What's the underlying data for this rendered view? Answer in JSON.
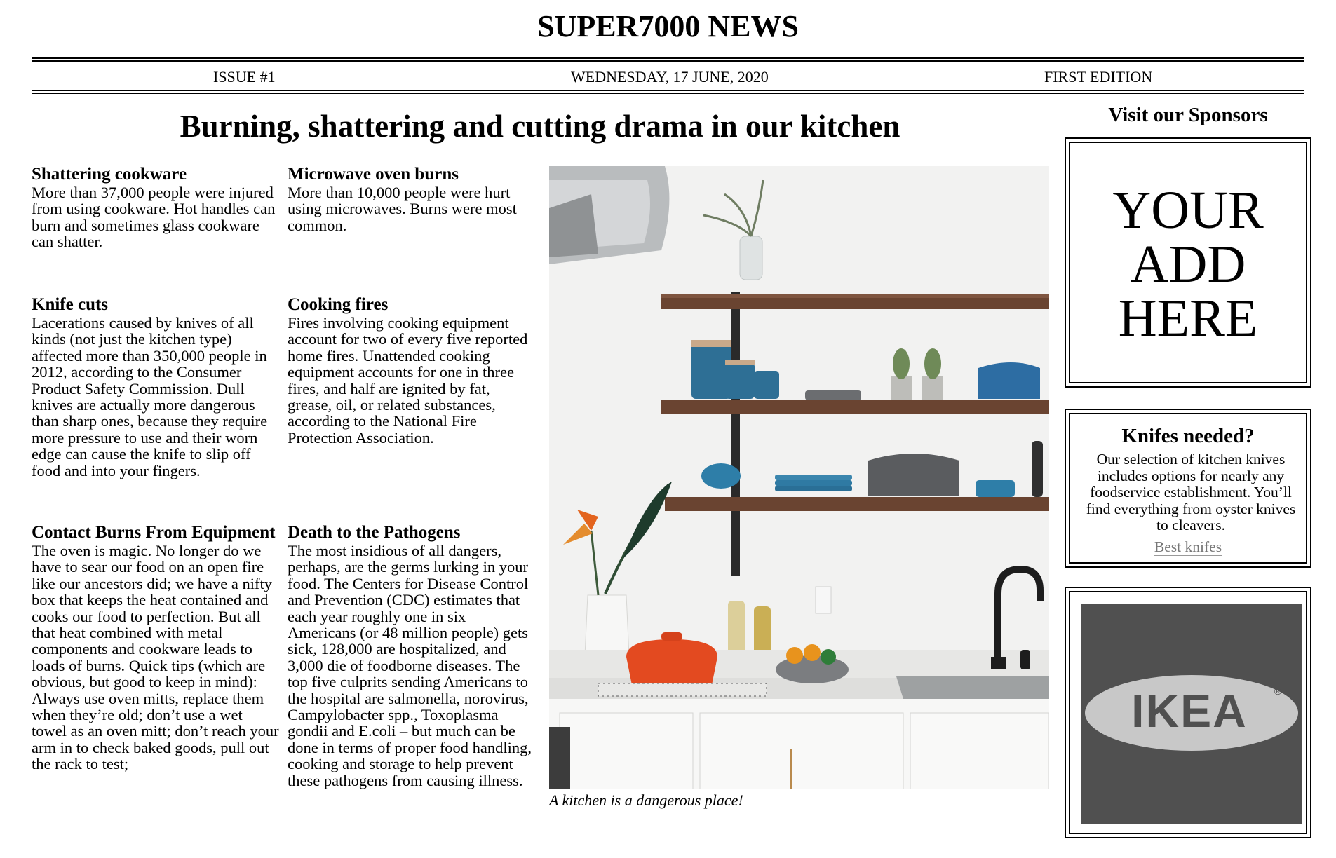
{
  "masthead": {
    "title": "SUPER7000 NEWS"
  },
  "issue_bar": {
    "issue": "ISSUE #1",
    "date": "WEDNESDAY, 17 JUNE, 2020",
    "edition": "FIRST EDITION"
  },
  "headline": "Burning, shattering and cutting drama in our kitchen",
  "articles": [
    {
      "title": "Shattering cookware",
      "body": "More than 37,000 people were injured from using cookware. Hot handles can burn and sometimes glass cookware can shatter."
    },
    {
      "title": "Microwave oven burns",
      "body": "More than 10,000 people were hurt using microwaves. Burns were most common."
    },
    {
      "title": "Knife cuts",
      "body": "Lacerations caused by knives of all kinds (not just the kitchen type) affected more than 350,000 people in 2012, according to the Consumer Product Safety Commission. Dull knives are actually more dangerous than sharp ones, because they require more pressure to use and their worn edge can cause the knife to slip off food and into your fingers."
    },
    {
      "title": "Cooking fires",
      "body": "Fires involving cooking equipment account for two of every five reported home fires. Unattended cooking equipment accounts for one in three fires, and half are ignited by fat, grease, oil, or related substances, according to the National Fire Protection Association."
    },
    {
      "title": "Contact Burns From Equipment",
      "body": "The oven is magic. No longer do we have to sear our food on an open fire like our ancestors did; we have a nifty box that keeps the heat contained and cooks our food to perfection. But all that heat combined with metal components and cookware leads to loads of burns. Quick tips (which are obvious, but good to keep in mind): Always use oven mitts, replace them when they’re old; don’t use a wet towel as an oven mitt; don’t reach your arm in to check baked goods, pull out the rack to test;"
    },
    {
      "title": "Death to the Pathogens",
      "body": "The most insidious of all dangers, perhaps, are the germs lurking in your food. The Centers for Disease Control and Prevention (CDC) estimates that each year roughly one in six Americans (or 48 million people) gets sick, 128,000 are hospitalized, and 3,000 die of foodborne diseases. The top five culprits sending Americans to the hospital are salmonella, norovirus, Campylobacter spp., Toxoplasma gondii and E.coli – but much can be done in terms of proper food handling, cooking and storage to help prevent these pathogens from causing illness."
    }
  ],
  "photo": {
    "caption": "A kitchen is a dangerous place!",
    "icon": "kitchen-photo"
  },
  "sidebar": {
    "title": "Visit our Sponsors",
    "ad_placeholder": "YOUR\nADD\nHERE",
    "knives": {
      "title": "Knifes needed?",
      "body": "Our selection of kitchen knives includes options for nearly any foodservice establishment. You’ll find everything from oyster knives to cleavers.",
      "link": "Best knifes"
    },
    "sponsor_logo": {
      "text": "IKEA",
      "mark": "®",
      "background": "#505050",
      "oval": "#c8c8c8"
    }
  }
}
